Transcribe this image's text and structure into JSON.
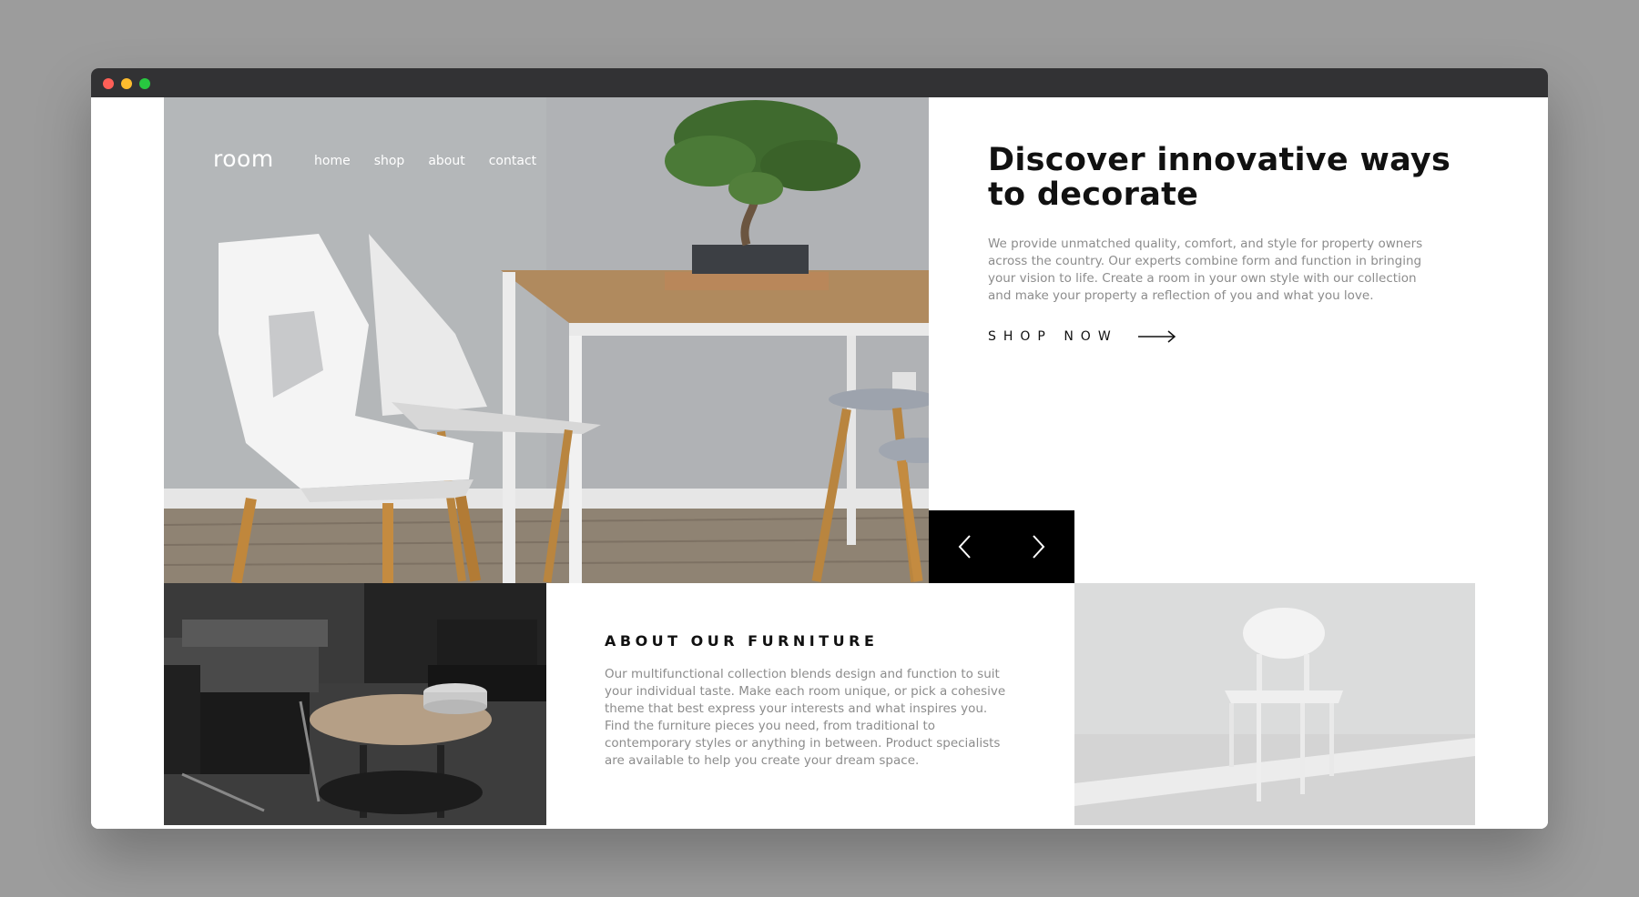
{
  "nav": {
    "logo": "room",
    "links": [
      "home",
      "shop",
      "about",
      "contact"
    ]
  },
  "hero": {
    "headline": "Discover innovative ways to decorate",
    "description": "We provide unmatched quality, comfort, and style for property owners across the country. Our experts combine form and function in bringing your vision to life. Create a room in your own style with our collection and make your property a reflection of you and what you love.",
    "cta_label": "SHOP NOW",
    "cta_icon": "arrow-right-icon",
    "image": "white chairs and wooden table with bonsai"
  },
  "slider": {
    "prev_icon": "chevron-left-icon",
    "next_icon": "chevron-right-icon"
  },
  "about": {
    "title": "ABOUT OUR FURNITURE",
    "text": "Our multifunctional collection blends design and function to suit your individual taste. Make each room unique, or pick a cohesive theme that best express your interests and what inspires you. Find the furniture pieces you need, from traditional to contemporary styles or anything in between. Product specialists are available to help you create your dream space."
  },
  "colors": {
    "background": "#9c9c9c",
    "titlebar": "#323234",
    "heading": "#111111",
    "body_text": "#8c8c8c",
    "slider_bg": "#000000"
  }
}
